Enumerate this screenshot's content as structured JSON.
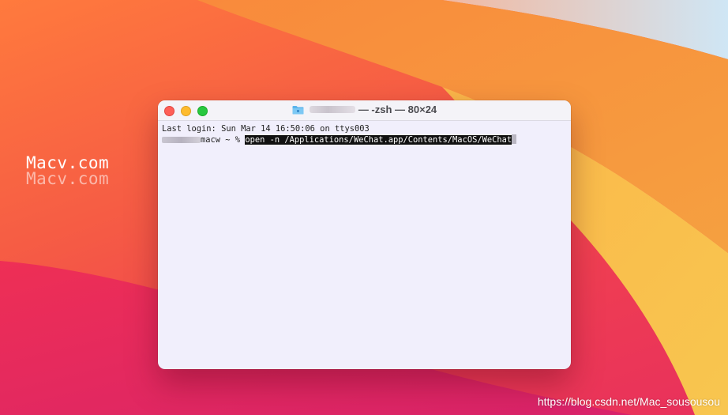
{
  "desktop": {
    "wallpaper_colors": [
      "#ff7a3d",
      "#f55a45",
      "#ef3e52",
      "#f6c44a"
    ],
    "watermark_text": "Macv.com",
    "credit_text": "https://blog.csdn.net/Mac_sousousou"
  },
  "terminal_window": {
    "title_icon": "folder-icon",
    "title_text": "— -zsh — 80×24",
    "lines": {
      "last_login": "Last login: Sun Mar 14 16:50:06 on ttys003",
      "prompt_host": "macw ~ % ",
      "command": "open -n /Applications/WeChat.app/Contents/MacOS/WeChat"
    }
  }
}
